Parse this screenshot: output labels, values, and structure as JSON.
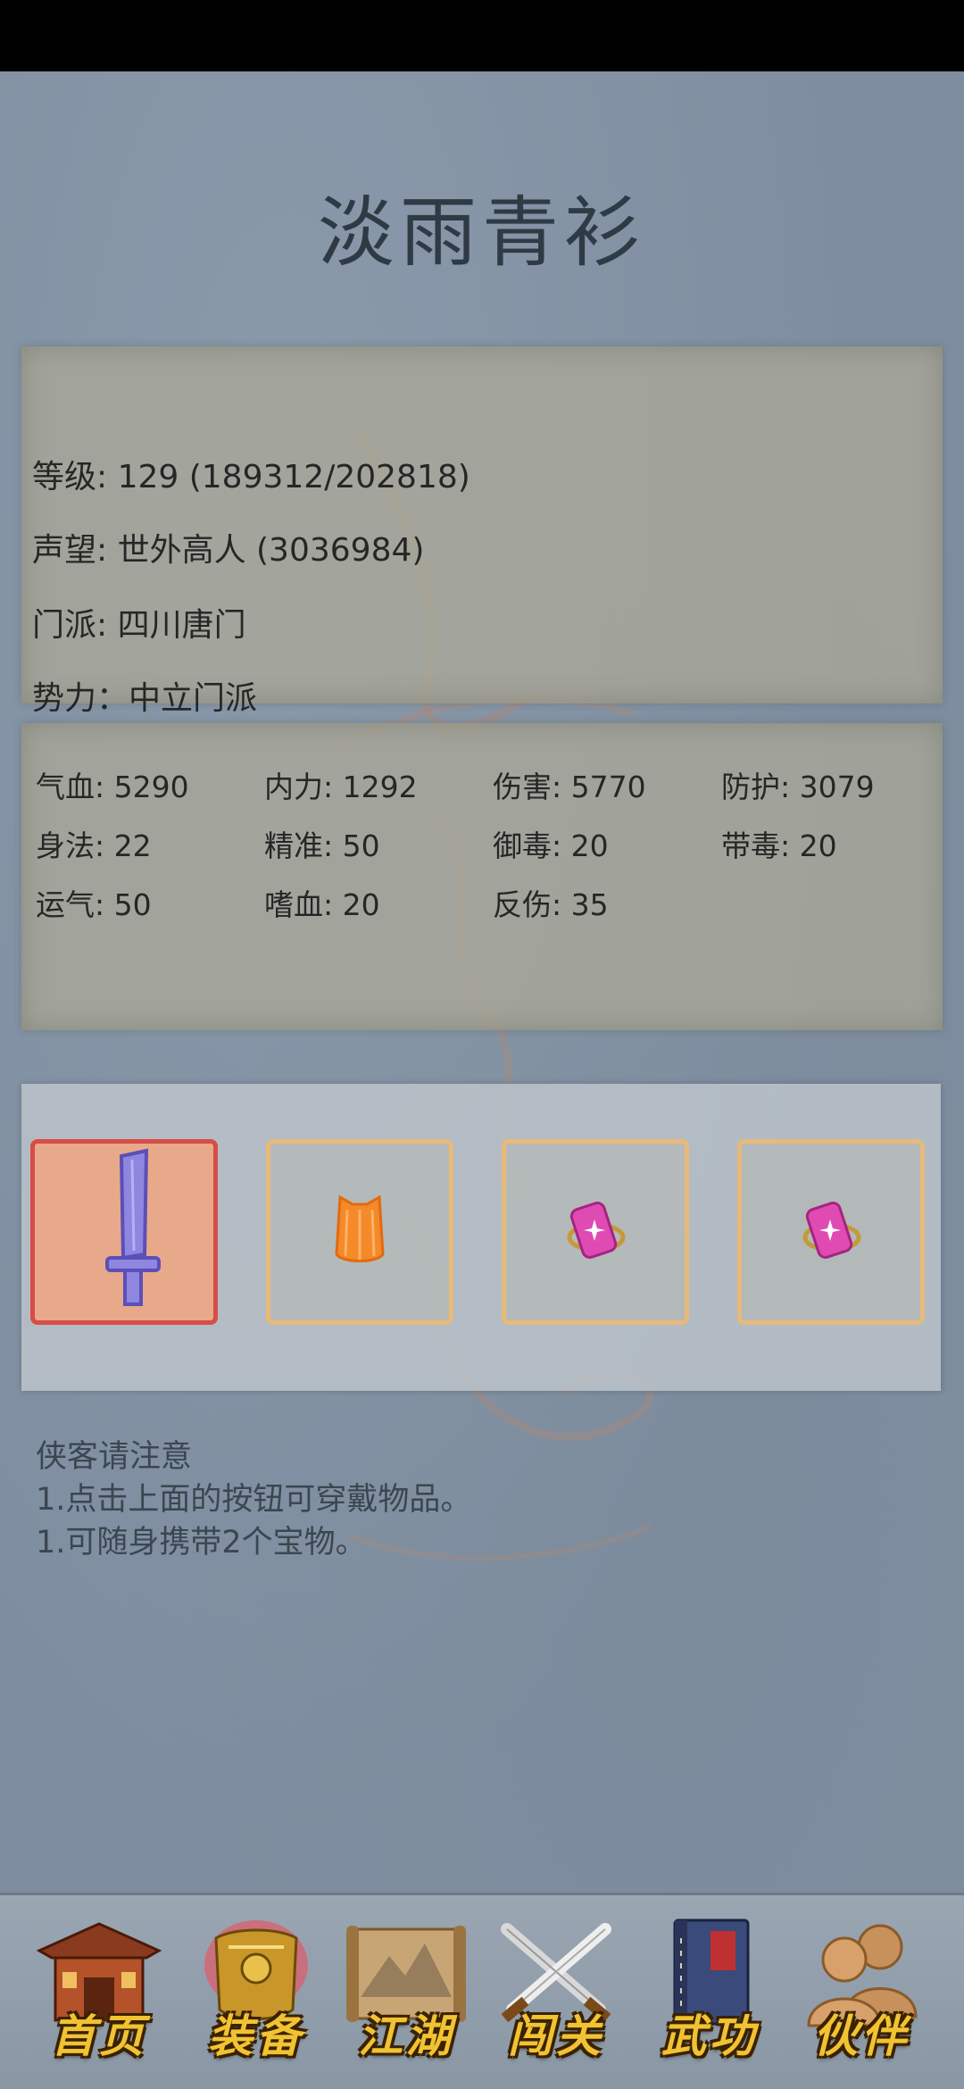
{
  "character": {
    "name": "淡雨青衫"
  },
  "info": {
    "level": "等级: 129 (189312/202818)",
    "reputation": "声望: 世外高人 (3036984)",
    "sect": "门派: 四川唐门",
    "faction": "势力：中立门派"
  },
  "stats": [
    "气血: 5290",
    "内力: 1292",
    "伤害: 5770",
    "防护: 3079",
    "身法: 22",
    "精准: 50",
    "御毒: 20",
    "带毒: 20",
    "运气: 50",
    "嗜血: 20",
    "反伤: 35"
  ],
  "equipment": [
    {
      "item": "sword-icon",
      "selected": true
    },
    {
      "item": "robe-icon",
      "selected": false
    },
    {
      "item": "treasure-icon",
      "selected": false
    },
    {
      "item": "treasure-icon",
      "selected": false
    }
  ],
  "notice": {
    "title": "侠客请注意",
    "line1": "1.点击上面的按钮可穿戴物品。",
    "line2": "1.可随身携带2个宝物。"
  },
  "nav": {
    "home": "首页",
    "equipment": "装备",
    "jianghu": "江湖",
    "challenge": "闯关",
    "martial": "武功",
    "partners": "伙伴"
  },
  "colors": {
    "background": "#7e8ea0",
    "nav_label": "#f1c232",
    "slot_border": "#e8b979",
    "slot_active_border": "#d84c48"
  }
}
